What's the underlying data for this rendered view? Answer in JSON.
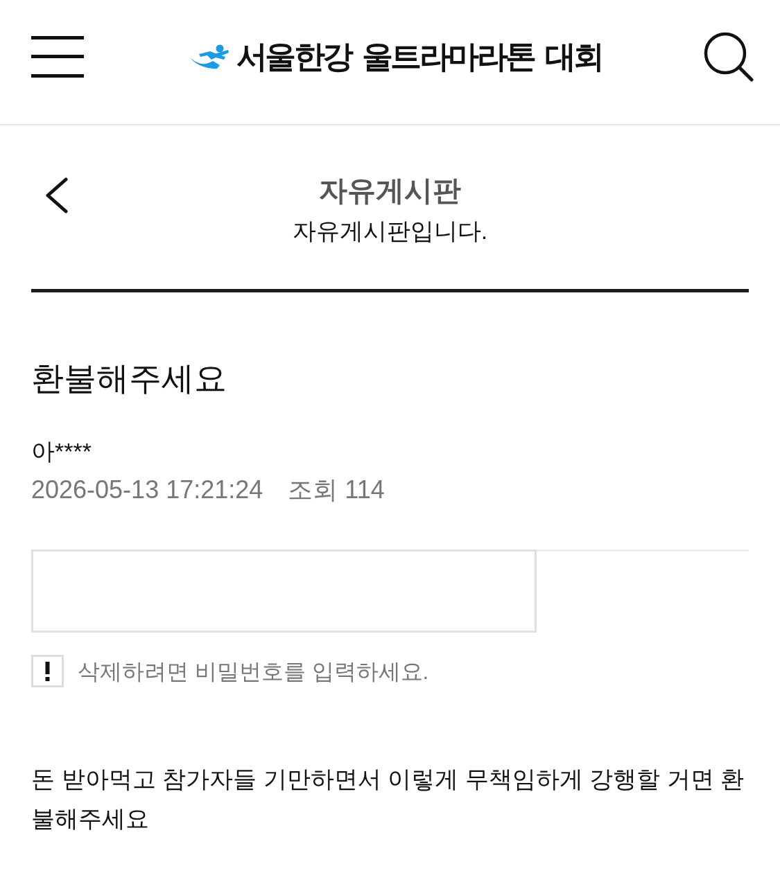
{
  "header": {
    "logo_text": "서울한강 울트라마라톤 대회"
  },
  "board": {
    "title": "자유게시판",
    "description": "자유게시판입니다."
  },
  "post": {
    "title": "환불해주세요",
    "author": "아****",
    "date": "2026-05-13 17:21:24",
    "views": "조회 114"
  },
  "delete_form": {
    "notice": "삭제하려면 비밀번호를 입력하세요."
  },
  "post_body": "돈 받아먹고 참가자들 기만하면서 이렇게 무책임하게 강행할 거면 환불해주세요"
}
